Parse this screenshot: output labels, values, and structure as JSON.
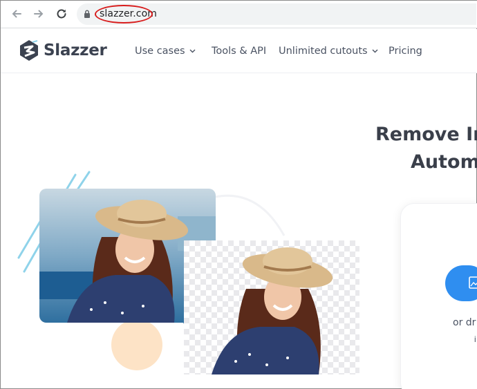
{
  "browser": {
    "back_icon": "arrow-left-icon",
    "forward_icon": "arrow-right-icon",
    "reload_icon": "reload-icon",
    "url": "slazzer.com"
  },
  "header": {
    "logo_text": "Slazzer",
    "menu": [
      {
        "label": "Use cases",
        "has_dropdown": true
      },
      {
        "label": "Tools & API",
        "has_dropdown": false
      },
      {
        "label": "Unlimited cutouts",
        "has_dropdown": true
      },
      {
        "label": "Pricing",
        "has_dropdown": false
      }
    ]
  },
  "hero": {
    "title_line1": "Remove Ir",
    "title_line2": "Autom",
    "card_text": "or dr",
    "card_text2": "i"
  },
  "colors": {
    "accent": "#2f8ef0",
    "highlight_circle": "#d81c1c",
    "peach": "#fde3c6",
    "stripes": "#8fd3ea"
  }
}
